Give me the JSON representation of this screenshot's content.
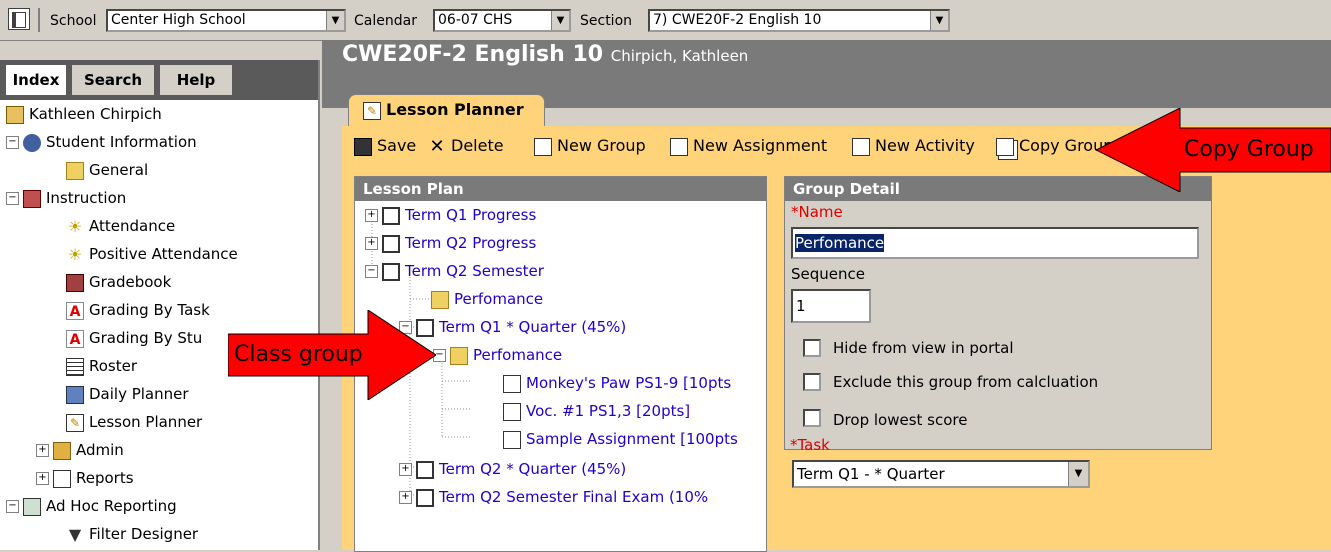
{
  "topbar": {
    "school_label": "School",
    "school_value": "Center High School",
    "calendar_label": "Calendar",
    "calendar_value": "06-07 CHS",
    "section_label": "Section",
    "section_value": "7) CWE20F-2 English 10"
  },
  "left_tabs": [
    "Index",
    "Search",
    "Help"
  ],
  "tree": {
    "user": "Kathleen Chirpich",
    "student_info": "Student Information",
    "general": "General",
    "instruction": "Instruction",
    "attendance": "Attendance",
    "positive_attendance": "Positive Attendance",
    "gradebook": "Gradebook",
    "grading_by_task": "Grading By Task",
    "grading_by_student": "Grading By Stu",
    "roster": "Roster",
    "daily_planner": "Daily Planner",
    "lesson_planner": "Lesson Planner",
    "admin": "Admin",
    "reports": "Reports",
    "ad_hoc": "Ad Hoc Reporting",
    "filter_designer": "Filter Designer"
  },
  "header": {
    "title": "CWE20F-2 English 10",
    "subtitle": "Chirpich, Kathleen",
    "tab": "Lesson Planner"
  },
  "toolbar": {
    "save": "Save",
    "delete": "Delete",
    "new_group": "New Group",
    "new_assignment": "New Assignment",
    "new_activity": "New Activity",
    "copy_group": "Copy Group"
  },
  "lesson_plan": {
    "header": "Lesson Plan",
    "items": [
      "Term Q1 Progress",
      "Term Q2 Progress",
      "Term Q2 Semester",
      "Perfomance",
      "Term Q1 * Quarter (45%)",
      "Perfomance",
      "Monkey's Paw PS1-9 [10pts",
      "Voc. #1 PS1,3 [20pts]",
      "Sample Assignment [100pts",
      "Term Q2 * Quarter (45%)",
      "Term Q2 Semester Final Exam (10%"
    ]
  },
  "group_detail": {
    "header": "Group Detail",
    "name_label": "*Name",
    "name_value": "Perfomance",
    "sequence_label": "Sequence",
    "sequence_value": "1",
    "hide_label": "Hide from view in portal",
    "exclude_label": "Exclude this group from calcluation",
    "drop_label": "Drop lowest score",
    "task_label": "*Task",
    "task_value": "Term Q1 - * Quarter"
  },
  "callouts": {
    "copy_group": "Copy Group",
    "class_group": "Class group"
  }
}
